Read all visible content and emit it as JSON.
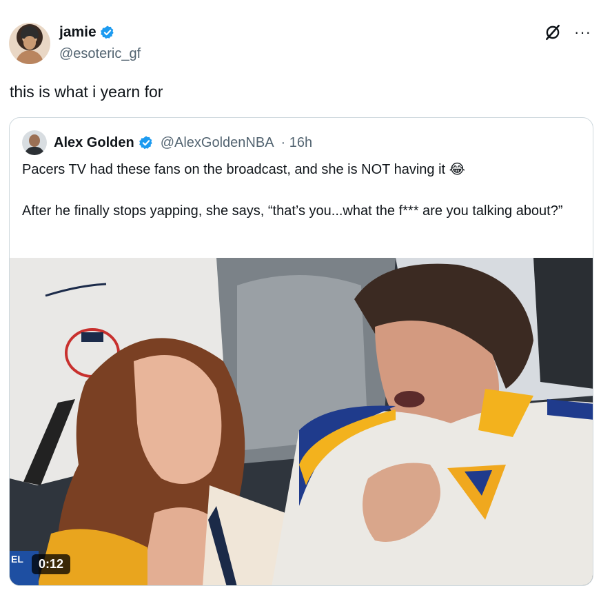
{
  "post": {
    "author": {
      "name": "jamie",
      "handle": "@esoteric_gf"
    },
    "text": "this is what i yearn for"
  },
  "quoted": {
    "author": {
      "name": "Alex Golden",
      "handle": "@AlexGoldenNBA",
      "time": "· 16h"
    },
    "text": "Pacers TV had these fans on the broadcast, and she is NOT having it 😂\n\nAfter he finally stops yapping, she says, “that’s you...what the f*** are you talking about?”",
    "video": {
      "duration": "0:12",
      "corner_text": "EL"
    }
  },
  "colors": {
    "verified": "#1d9bf0",
    "secondary_text": "#536471",
    "border": "#cfd9de"
  },
  "icons": {
    "verified": "verified-badge-icon",
    "grok": "grok-icon",
    "more": "more-options-icon"
  }
}
